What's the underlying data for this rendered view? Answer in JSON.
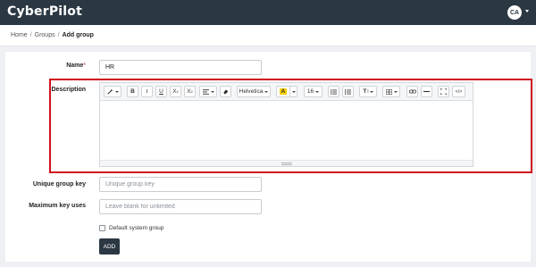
{
  "app": {
    "logo": "CyberPilot",
    "avatar_initials": "CA"
  },
  "breadcrumb": {
    "items": [
      "Home",
      "Groups",
      "Add group"
    ],
    "separator": "/"
  },
  "form": {
    "name": {
      "label": "Name",
      "required_mark": "*",
      "value": "HR"
    },
    "description": {
      "label": "Description",
      "toolbar": {
        "magic_icon": "magic-wand-icon",
        "bold": "B",
        "italic": "I",
        "underline": "U",
        "superscript": "X",
        "superscript_mark": "2",
        "subscript": "X",
        "subscript_mark": "2",
        "align_icon": "align-left-icon",
        "eraser_icon": "eraser-icon",
        "font_family": "Helvetica",
        "color_letter": "A",
        "highlight_color": "#f5d000",
        "font_size": "16",
        "unordered_list_icon": "unordered-list-icon",
        "ordered_list_icon": "ordered-list-icon",
        "text_height_label": "T",
        "text_height_mark": "I",
        "table_icon": "table-icon",
        "link_icon": "link-icon",
        "hr_icon": "horizontal-rule-icon",
        "fullscreen_icon": "fullscreen-icon",
        "codeview_label": "</>"
      }
    },
    "unique_key": {
      "label": "Unique group key",
      "placeholder": "Unique group key"
    },
    "max_uses": {
      "label": "Maximum key uses",
      "placeholder": "Leave blank for unlimited"
    },
    "default_group": {
      "label": "Default system group",
      "checked": false
    },
    "submit": {
      "label": "ADD"
    }
  },
  "colors": {
    "topbar": "#2b3843",
    "highlight_border": "#d0121b",
    "button": "#2b3843"
  }
}
